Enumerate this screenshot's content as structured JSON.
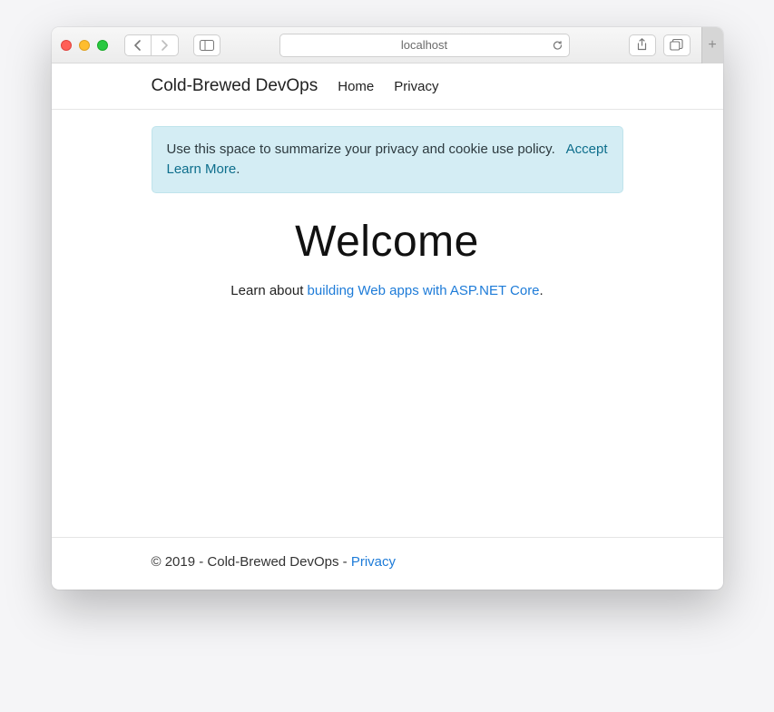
{
  "browser": {
    "url_display": "localhost"
  },
  "navbar": {
    "brand": "Cold-Brewed DevOps",
    "links": {
      "home": "Home",
      "privacy": "Privacy"
    }
  },
  "cookie_banner": {
    "message": "Use this space to summarize your privacy and cookie use policy.",
    "accept": "Accept",
    "learn_more": "Learn More",
    "trailing_punctuation": "."
  },
  "hero": {
    "title": "Welcome",
    "lead_prefix": "Learn about ",
    "lead_link": "building Web apps with ASP.NET Core",
    "lead_suffix": "."
  },
  "footer": {
    "text": "© 2019 - Cold-Brewed DevOps - ",
    "privacy": "Privacy"
  }
}
